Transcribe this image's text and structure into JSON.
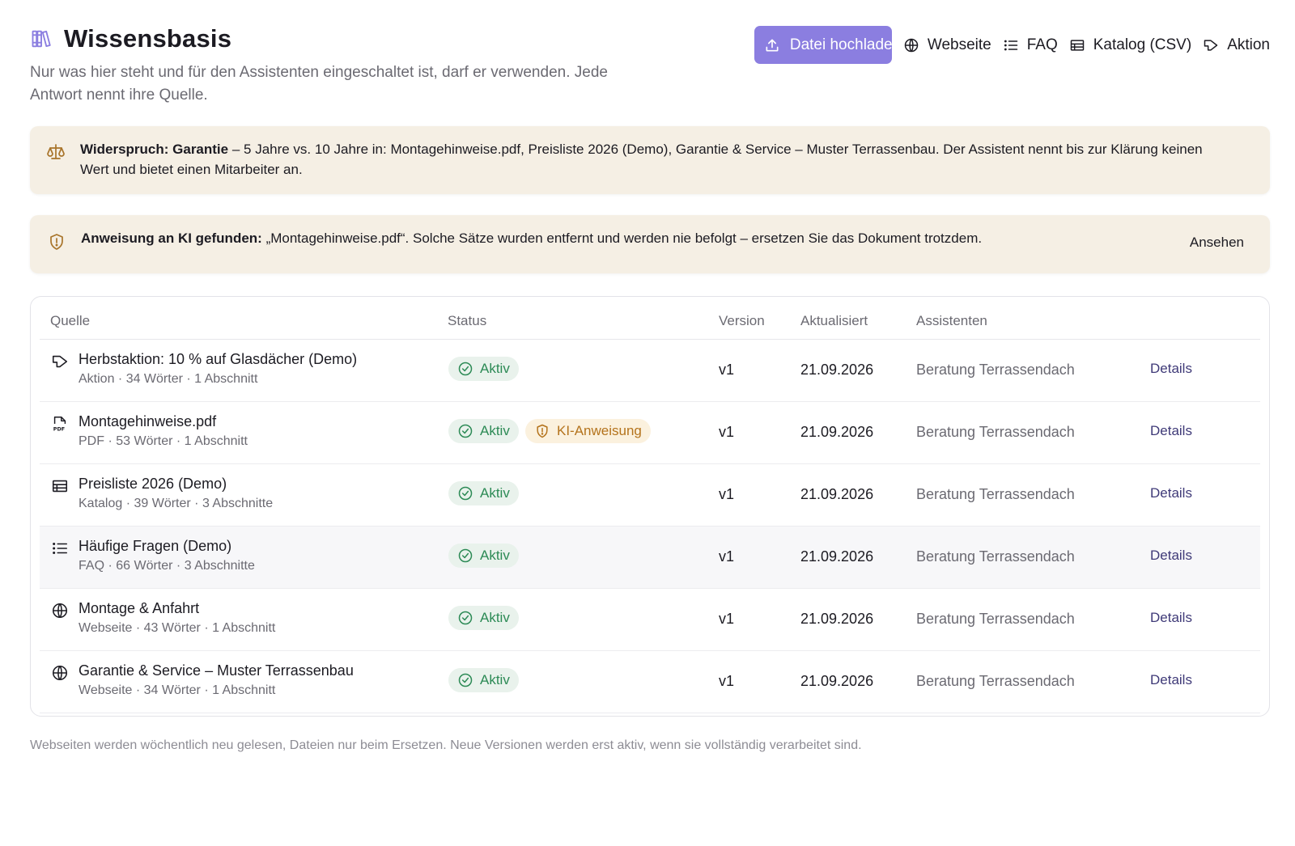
{
  "header": {
    "title": "Wissensbasis",
    "subtitle": "Nur was hier steht und für den Assistenten eingeschaltet ist, darf er verwenden. Jede Antwort nennt ihre Quelle.",
    "actions": {
      "upload": "Datei hochladen",
      "website": "Webseite",
      "faq": "FAQ",
      "catalog": "Katalog (CSV)",
      "promo": "Aktion"
    }
  },
  "alerts": {
    "conflict": {
      "title": "Widerspruch: Garantie",
      "text": " – 5 Jahre vs. 10 Jahre in: Montagehinweise.pdf, Preisliste 2026 (Demo), Garantie & Service – Muster Terrassenbau. Der Assistent nennt bis zur Klärung keinen Wert und bietet einen Mitarbeiter an."
    },
    "injection": {
      "title": "Anweisung an KI gefunden:",
      "text": " „Montagehinweise.pdf“. Solche Sätze wurden entfernt und werden nie befolgt – ersetzen Sie das Dokument trotzdem.",
      "link": "Ansehen"
    }
  },
  "table": {
    "columns": {
      "source": "Quelle",
      "status": "Status",
      "version": "Version",
      "updated": "Aktualisiert",
      "assistants": "Assistenten"
    },
    "rows": [
      {
        "icon": "megaphone-icon",
        "name": "Herbstaktion: 10 % auf Glasdächer (Demo)",
        "meta": "Aktion · 34 Wörter · 1 Abschnitt",
        "status": "Aktiv",
        "flag": "",
        "version": "v1",
        "updated": "21.09.2026",
        "assistant": "Beratung Terrassendach",
        "action": "Details"
      },
      {
        "icon": "pdf-icon",
        "name": "Montagehinweise.pdf",
        "meta": "PDF · 53 Wörter · 1 Abschnitt",
        "status": "Aktiv",
        "flag": "KI-Anweisung",
        "version": "v1",
        "updated": "21.09.2026",
        "assistant": "Beratung Terrassendach",
        "action": "Details"
      },
      {
        "icon": "table-icon",
        "name": "Preisliste 2026 (Demo)",
        "meta": "Katalog · 39 Wörter · 3 Abschnitte",
        "status": "Aktiv",
        "flag": "",
        "version": "v1",
        "updated": "21.09.2026",
        "assistant": "Beratung Terrassendach",
        "action": "Details"
      },
      {
        "icon": "list-icon",
        "name": "Häufige Fragen (Demo)",
        "meta": "FAQ · 66 Wörter · 3 Abschnitte",
        "status": "Aktiv",
        "flag": "",
        "version": "v1",
        "updated": "21.09.2026",
        "assistant": "Beratung Terrassendach",
        "action": "Details"
      },
      {
        "icon": "globe-icon",
        "name": "Montage & Anfahrt",
        "meta": "Webseite · 43 Wörter · 1 Abschnitt",
        "status": "Aktiv",
        "flag": "",
        "version": "v1",
        "updated": "21.09.2026",
        "assistant": "Beratung Terrassendach",
        "action": "Details"
      },
      {
        "icon": "globe-icon",
        "name": "Garantie & Service – Muster Terrassenbau",
        "meta": "Webseite · 34 Wörter · 1 Abschnitt",
        "status": "Aktiv",
        "flag": "",
        "version": "v1",
        "updated": "21.09.2026",
        "assistant": "Beratung Terrassendach",
        "action": "Details"
      }
    ]
  },
  "footnote": "Webseiten werden wöchentlich neu gelesen, Dateien nur beim Ersetzen. Neue Versionen werden erst aktiv, wenn sie vollständig verarbeitet sind.",
  "colors": {
    "accent": "#8b7ee0",
    "alert_bg": "#f5efe4",
    "success": "#2c8a55",
    "warning": "#b4731c"
  }
}
